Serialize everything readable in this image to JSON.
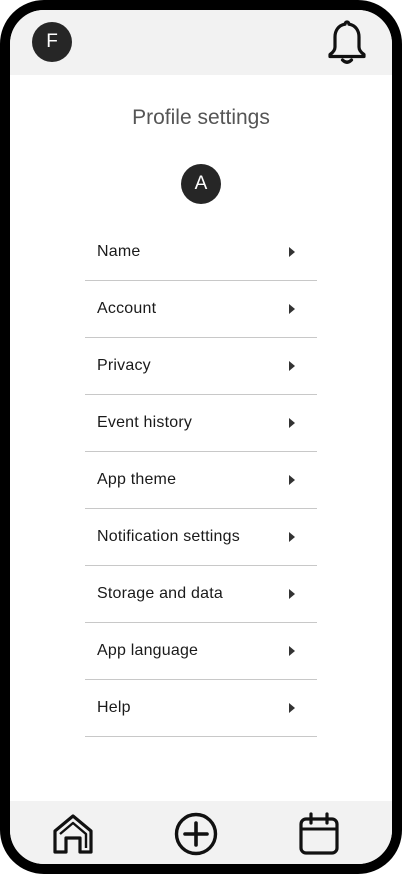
{
  "header": {
    "user_initial": "F",
    "notification_icon": "bell-icon"
  },
  "main": {
    "title": "Profile settings",
    "profile_initial": "A",
    "items": [
      {
        "label": "Name"
      },
      {
        "label": "Account"
      },
      {
        "label": "Privacy"
      },
      {
        "label": "Event history"
      },
      {
        "label": "App theme"
      },
      {
        "label": "Notification settings"
      },
      {
        "label": "Storage and data"
      },
      {
        "label": "App language"
      },
      {
        "label": "Help"
      }
    ],
    "item_chevron_icon": "chevron-right-icon"
  },
  "bottom_nav": {
    "items": [
      {
        "icon": "home-icon"
      },
      {
        "icon": "plus-circle-icon"
      },
      {
        "icon": "calendar-icon"
      }
    ]
  },
  "colors": {
    "avatar_bg": "#262626",
    "bar_bg": "#f2f2f2",
    "divider": "#c8c8c8",
    "title_text": "#555555"
  }
}
